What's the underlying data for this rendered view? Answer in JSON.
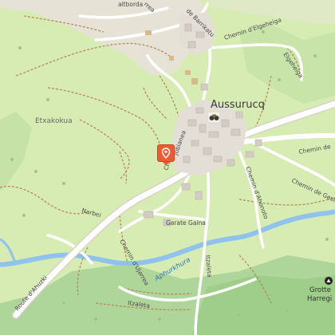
{
  "map": {
    "town": "Aussurucq",
    "places": {
      "etxakokua": "Etxakokua",
      "grotte_line1": "Grotte",
      "grotte_line2": "Harregi"
    },
    "roads": {
      "route_ahuzki": "Route d'Ahuzki",
      "chemin_elgeheiga": "Chemin d'Elgeheiga",
      "elgeheiga": "Elgeheiga",
      "chemin_de_gesta": "Chemin de Gesta",
      "chemin_de_right": "Chemin de",
      "chemin_ahoneto": "Chemin d'Ahonoto",
      "garate_gaina": "Garate Gaina",
      "chemin_ujarrea": "Chemin d'Ujarrea",
      "itzaleta_v": "Itzaleta",
      "itzaleta_h": "Itzaleta",
      "nabel": "Narbei",
      "jobianea": "Jobianea",
      "chemin_ste": "Che",
      "barrikatu": "de Barrikatu",
      "haltborda": "altborda",
      "rrea": "rrea"
    },
    "river": "Aphurkhura",
    "colors": {
      "land": "#d7ecb3",
      "rocky": "#e4e1d3",
      "forest": "#add19e",
      "road": "#ffffff",
      "river": "#8fc3ee",
      "marker": "#ef5a32",
      "building": "#d3ccc4"
    },
    "icons": [
      "marker-icon",
      "viewpoint-icon",
      "cave-icon"
    ]
  }
}
